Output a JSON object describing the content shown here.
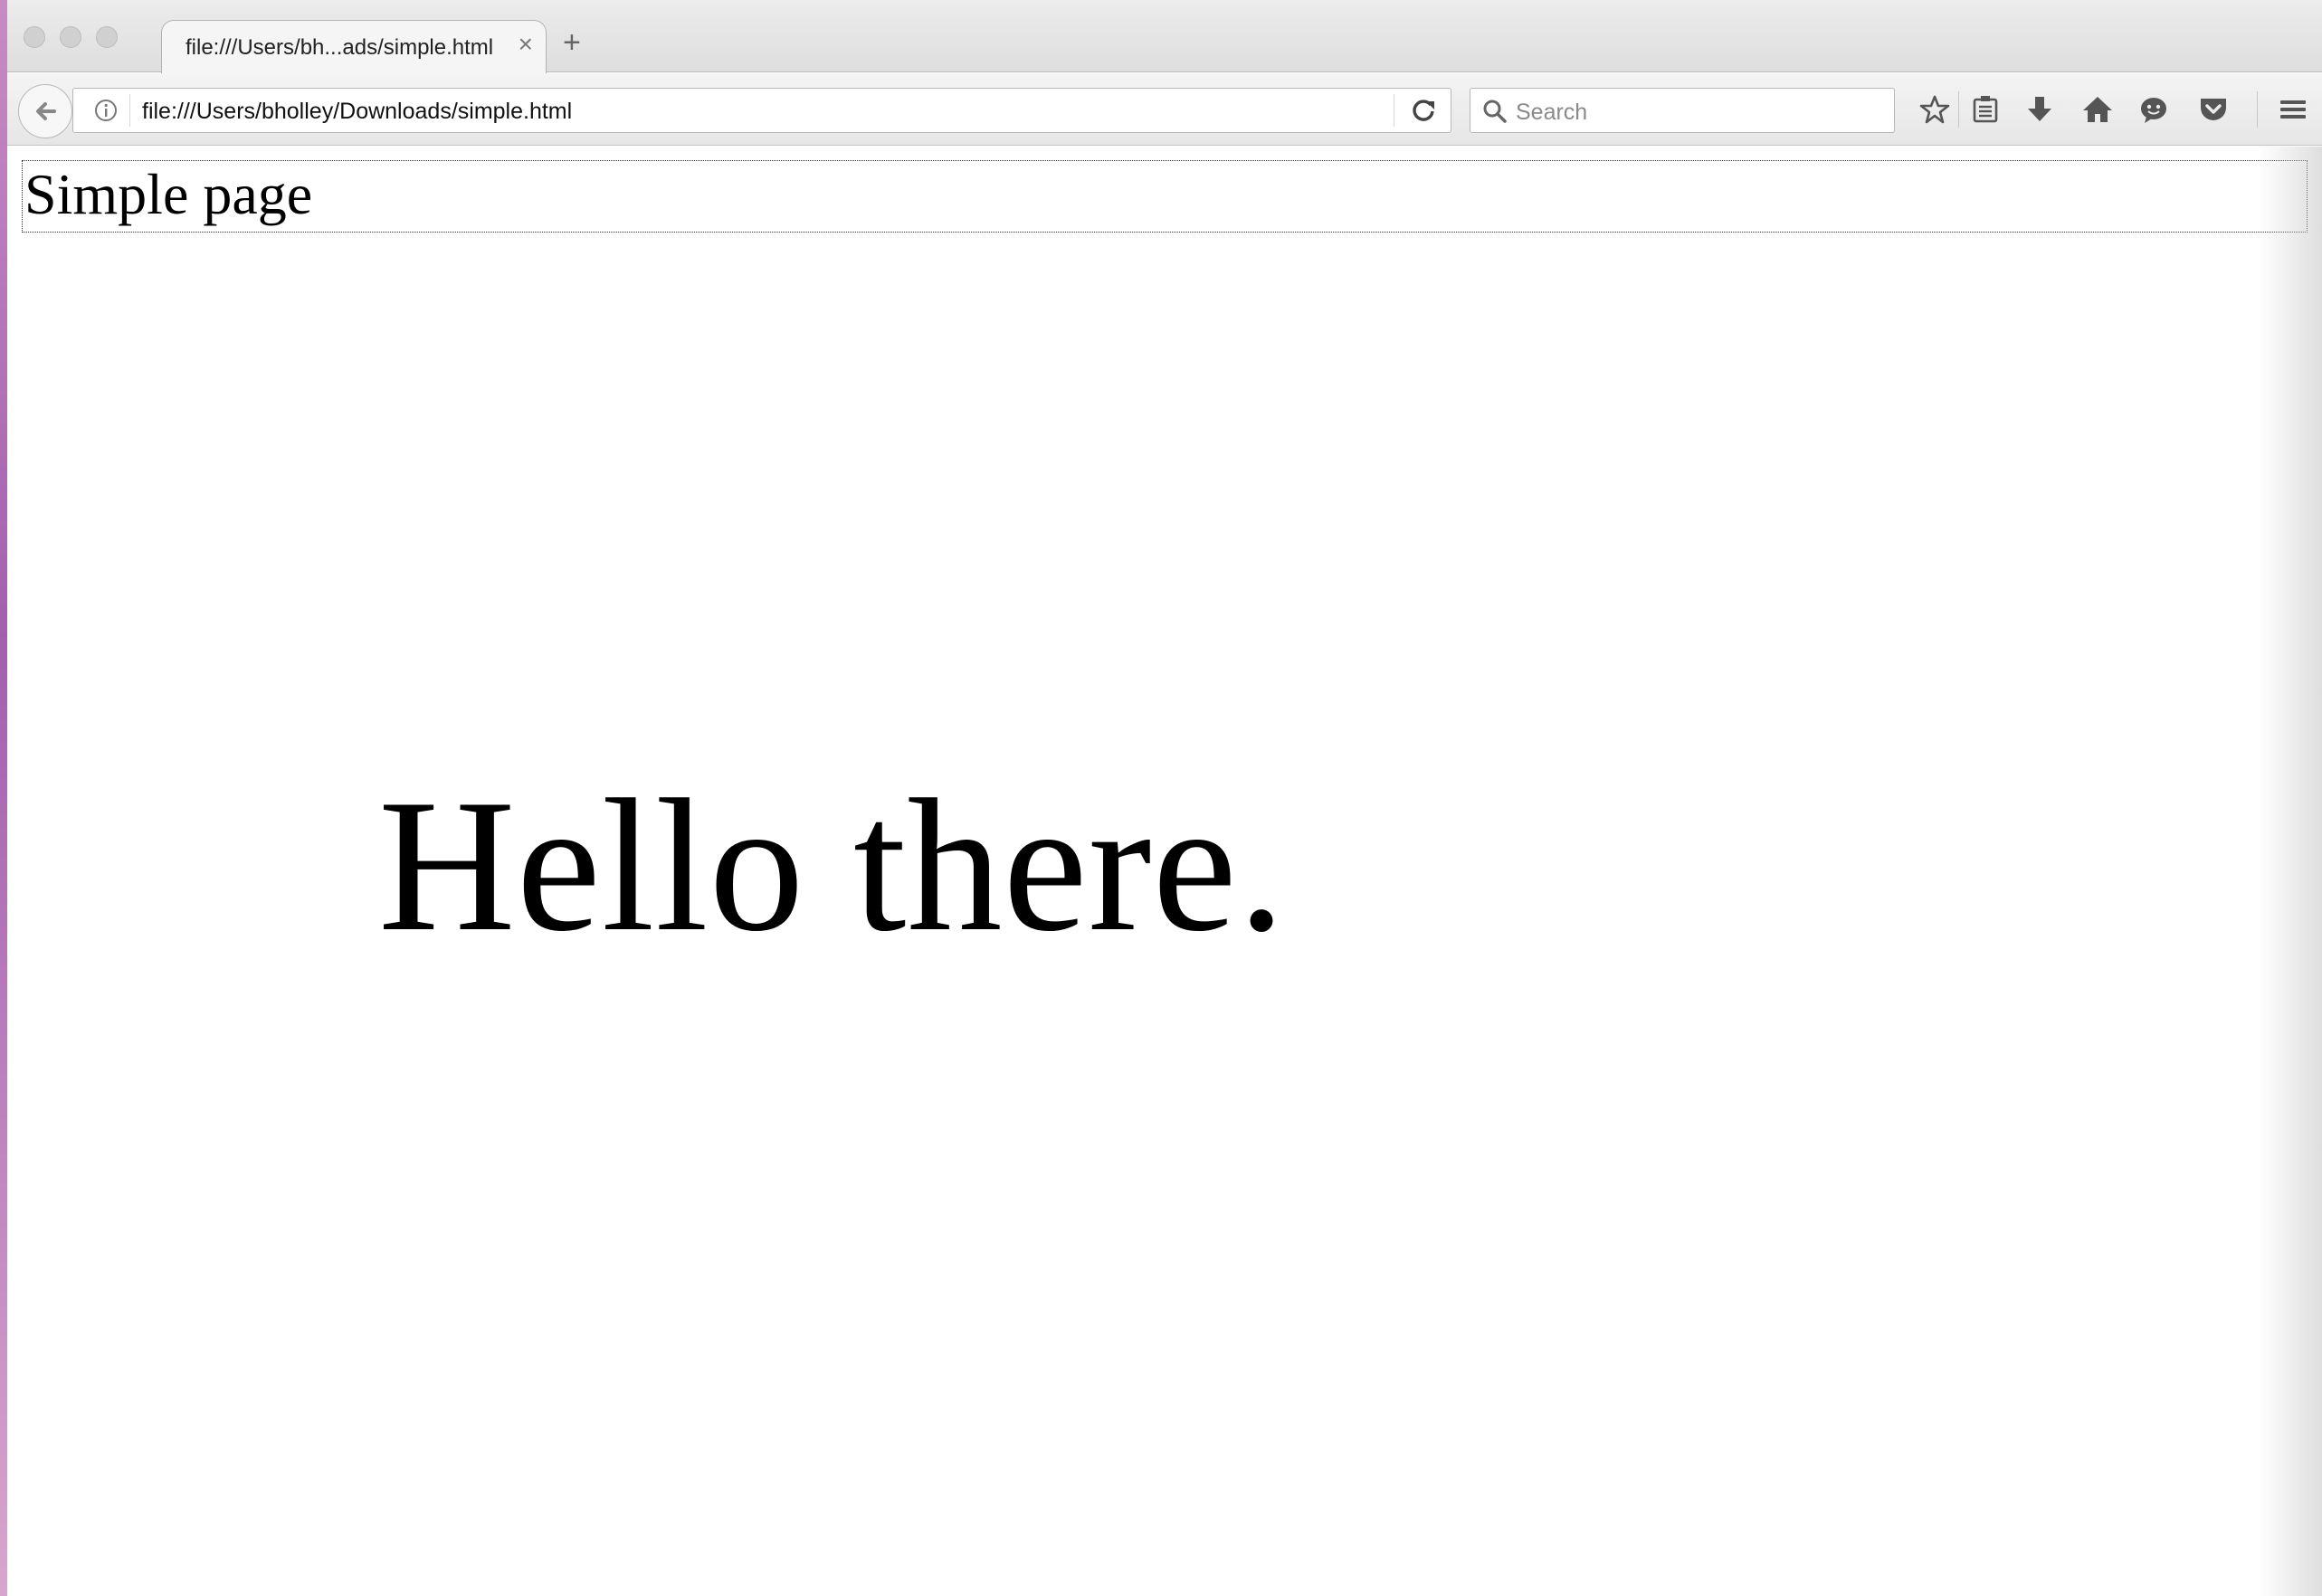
{
  "tab": {
    "title": "file:///Users/bh...ads/simple.html",
    "close": "×"
  },
  "new_tab": "+",
  "navbar": {
    "url": "file:///Users/bholley/Downloads/simple.html",
    "search_placeholder": "Search"
  },
  "page": {
    "heading": "Simple page",
    "body_text": "Hello there."
  },
  "icons": [
    "back-arrow-icon",
    "info-icon",
    "reload-icon",
    "search-icon",
    "bookmark-star-icon",
    "reading-list-icon",
    "download-icon",
    "home-icon",
    "emoji-icon",
    "pocket-icon",
    "menu-icon"
  ]
}
